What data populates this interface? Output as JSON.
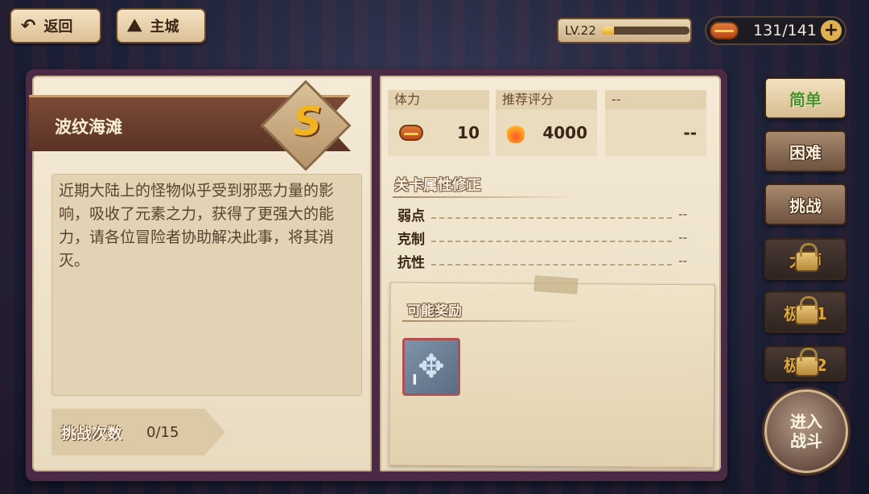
{
  "top_bar": {
    "back_label": "返回",
    "main_city_label": "主城",
    "level_label": "LV.22",
    "level_progress": 0.15,
    "stamina_value": "131/141",
    "plus_symbol": "+"
  },
  "stage": {
    "name": "波纹海滩",
    "grade": "S",
    "description": "近期大陆上的怪物似乎受到邪恶力量的影响，吸收了元素之力，获得了更强大的能力，请各位冒险者协助解决此事，将其消灭。",
    "challenge_label": "挑战次数",
    "challenge_count": "0/15"
  },
  "stats": [
    {
      "label": "体力",
      "value": "10",
      "icon": "hotdog-icon"
    },
    {
      "label": "推荐评分",
      "value": "4000",
      "icon": "flame-icon"
    },
    {
      "label": "--",
      "value": "--",
      "icon": ""
    }
  ],
  "attributes": {
    "title": "关卡属性修正",
    "rows": [
      {
        "label": "弱点",
        "value": "--"
      },
      {
        "label": "克制",
        "value": "--"
      },
      {
        "label": "抗性",
        "value": "--"
      }
    ]
  },
  "rewards": {
    "title": "可能奖励",
    "items": [
      {
        "icon": "crystal-emblem-icon",
        "tier": "I"
      }
    ]
  },
  "difficulties": [
    {
      "label": "简单",
      "state": "active"
    },
    {
      "label": "困难",
      "state": "normal"
    },
    {
      "label": "挑战",
      "state": "normal"
    },
    {
      "label": "大师",
      "state": "locked"
    },
    {
      "label": "极限1",
      "state": "locked"
    },
    {
      "label": "极限2",
      "state": "locked"
    }
  ],
  "enter_button": {
    "line1": "进入",
    "line2": "战斗"
  }
}
